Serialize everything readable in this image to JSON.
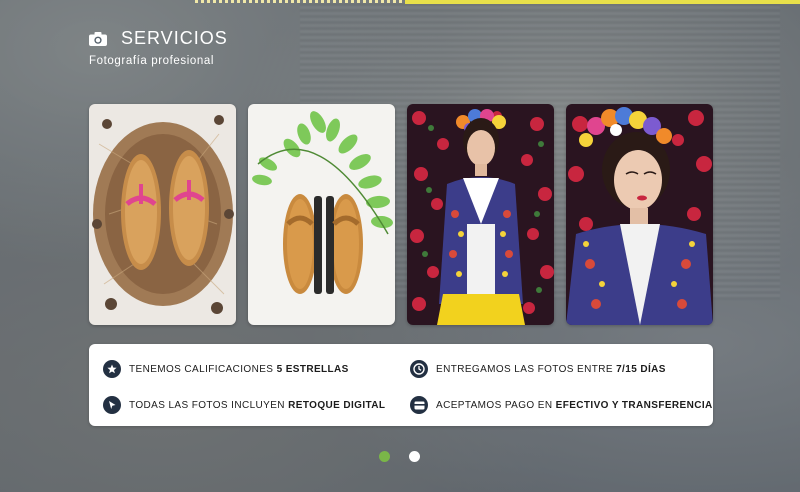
{
  "header": {
    "icon": "camera-icon",
    "title": "SERVICIOS",
    "subtitle": "Fotografía profesional"
  },
  "gallery": {
    "cards": [
      {
        "name": "sandals-on-pine-needles-photo"
      },
      {
        "name": "sandals-with-leaves-photo"
      },
      {
        "name": "woman-flower-crown-standing-photo"
      },
      {
        "name": "woman-flower-crown-closeup-photo"
      }
    ]
  },
  "features": [
    {
      "icon": "star-icon",
      "text": "TENEMOS CALIFICACIONES ",
      "bold": "5 ESTRELLAS"
    },
    {
      "icon": "clock-icon",
      "text": "ENTREGAMOS LAS FOTOS ENTRE ",
      "bold": "7/15 DÍAS"
    },
    {
      "icon": "cursor-icon",
      "text": "TODAS LAS FOTOS INCLUYEN ",
      "bold": "RETOQUE DIGITAL"
    },
    {
      "icon": "credit-card-icon",
      "text": "ACEPTAMOS PAGO EN ",
      "bold": "EFECTIVO Y TRANSFERENCIA"
    }
  ],
  "pagination": {
    "current": 1,
    "total": 2
  },
  "colors": {
    "accent_green": "#7ab648",
    "icon_navy": "#233042",
    "top_bar_yellow": "#e8e04a"
  }
}
